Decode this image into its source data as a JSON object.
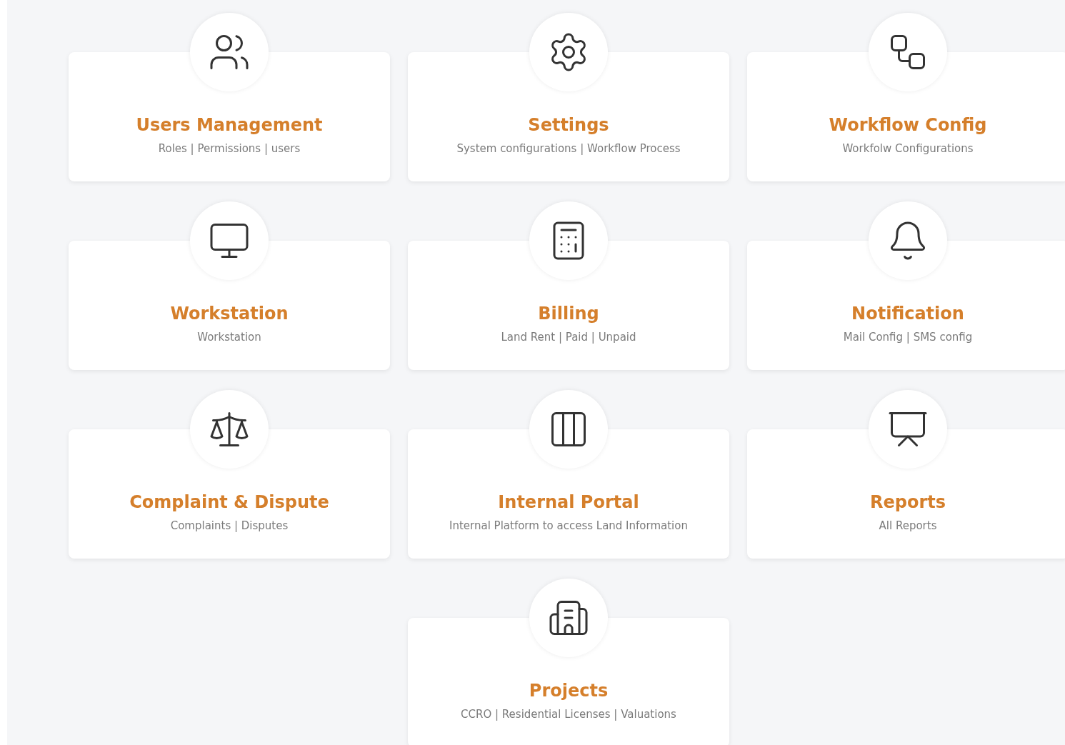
{
  "cards": [
    {
      "title": "Users Management",
      "subtitle": "Roles | Permissions | users"
    },
    {
      "title": "Settings",
      "subtitle": "System configurations | Workflow Process"
    },
    {
      "title": "Workflow Config",
      "subtitle": "Workfolw Configurations"
    },
    {
      "title": "Workstation",
      "subtitle": "Workstation"
    },
    {
      "title": "Billing",
      "subtitle": "Land Rent | Paid | Unpaid"
    },
    {
      "title": "Notification",
      "subtitle": "Mail Config | SMS config"
    },
    {
      "title": "Complaint & Dispute",
      "subtitle": "Complaints | Disputes"
    },
    {
      "title": "Internal Portal",
      "subtitle": "Internal Platform to access Land Information"
    },
    {
      "title": "Reports",
      "subtitle": "All Reports"
    },
    {
      "title": "Projects",
      "subtitle": "CCRO | Residential Licenses | Valuations"
    }
  ]
}
